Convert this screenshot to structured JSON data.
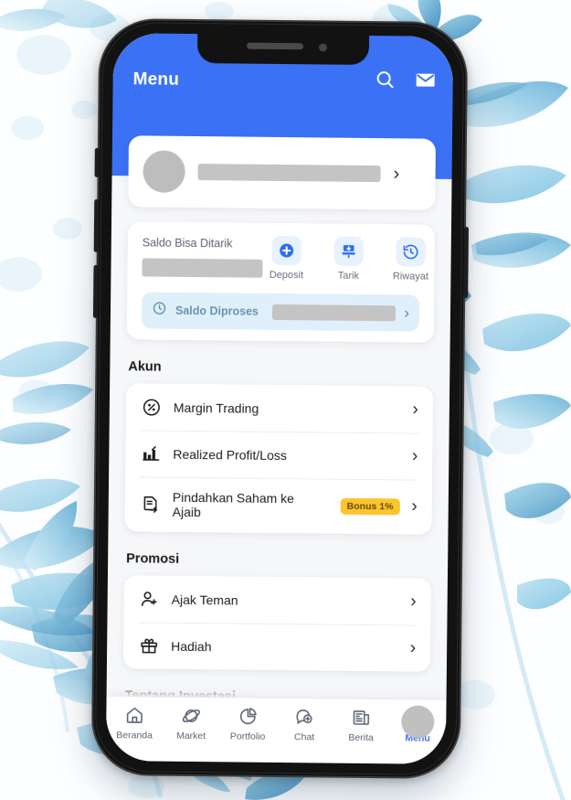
{
  "appbar": {
    "title": "Menu",
    "search_icon": "search-icon",
    "mail_icon": "mail-icon"
  },
  "profile": {
    "name_redacted": true,
    "chevron": "›"
  },
  "balance": {
    "label": "Saldo Bisa Ditarik",
    "amount_redacted": true,
    "actions": [
      {
        "label": "Deposit",
        "icon": "plus-circle-icon"
      },
      {
        "label": "Tarik",
        "icon": "atm-withdraw-icon"
      },
      {
        "label": "Riwayat",
        "icon": "history-clock-icon"
      }
    ],
    "processed": {
      "label": "Saldo Diproses",
      "icon": "clock-icon",
      "value_redacted": true,
      "chevron": "›"
    }
  },
  "sections": [
    {
      "title": "Akun",
      "items": [
        {
          "label": "Margin Trading",
          "icon": "percent-circle-icon",
          "badge": null
        },
        {
          "label": "Realized Profit/Loss",
          "icon": "bar-chart-icon",
          "badge": null
        },
        {
          "label": "Pindahkan Saham ke Ajaib",
          "icon": "document-transfer-icon",
          "badge": "Bonus 1%"
        }
      ]
    },
    {
      "title": "Promosi",
      "items": [
        {
          "label": "Ajak Teman",
          "icon": "person-add-icon",
          "badge": null
        },
        {
          "label": "Hadiah",
          "icon": "gift-icon",
          "badge": null
        }
      ]
    },
    {
      "title": "Tentang Investasi",
      "items": []
    }
  ],
  "tabbar": {
    "items": [
      {
        "label": "Beranda",
        "icon": "home-icon",
        "active": false
      },
      {
        "label": "Market",
        "icon": "planet-icon",
        "active": false
      },
      {
        "label": "Portfolio",
        "icon": "pie-chart-icon",
        "active": false
      },
      {
        "label": "Chat",
        "icon": "chat-bubble-icon",
        "active": false
      },
      {
        "label": "Berita",
        "icon": "news-icon",
        "active": false
      },
      {
        "label": "Menu",
        "icon": "avatar-icon",
        "active": true
      }
    ]
  },
  "chevron": "›",
  "colors": {
    "brand_blue": "#3b71f5",
    "badge_yellow": "#fbc52d",
    "processed_bg": "#dff0fb",
    "redact_gray": "#c4c4c4"
  }
}
